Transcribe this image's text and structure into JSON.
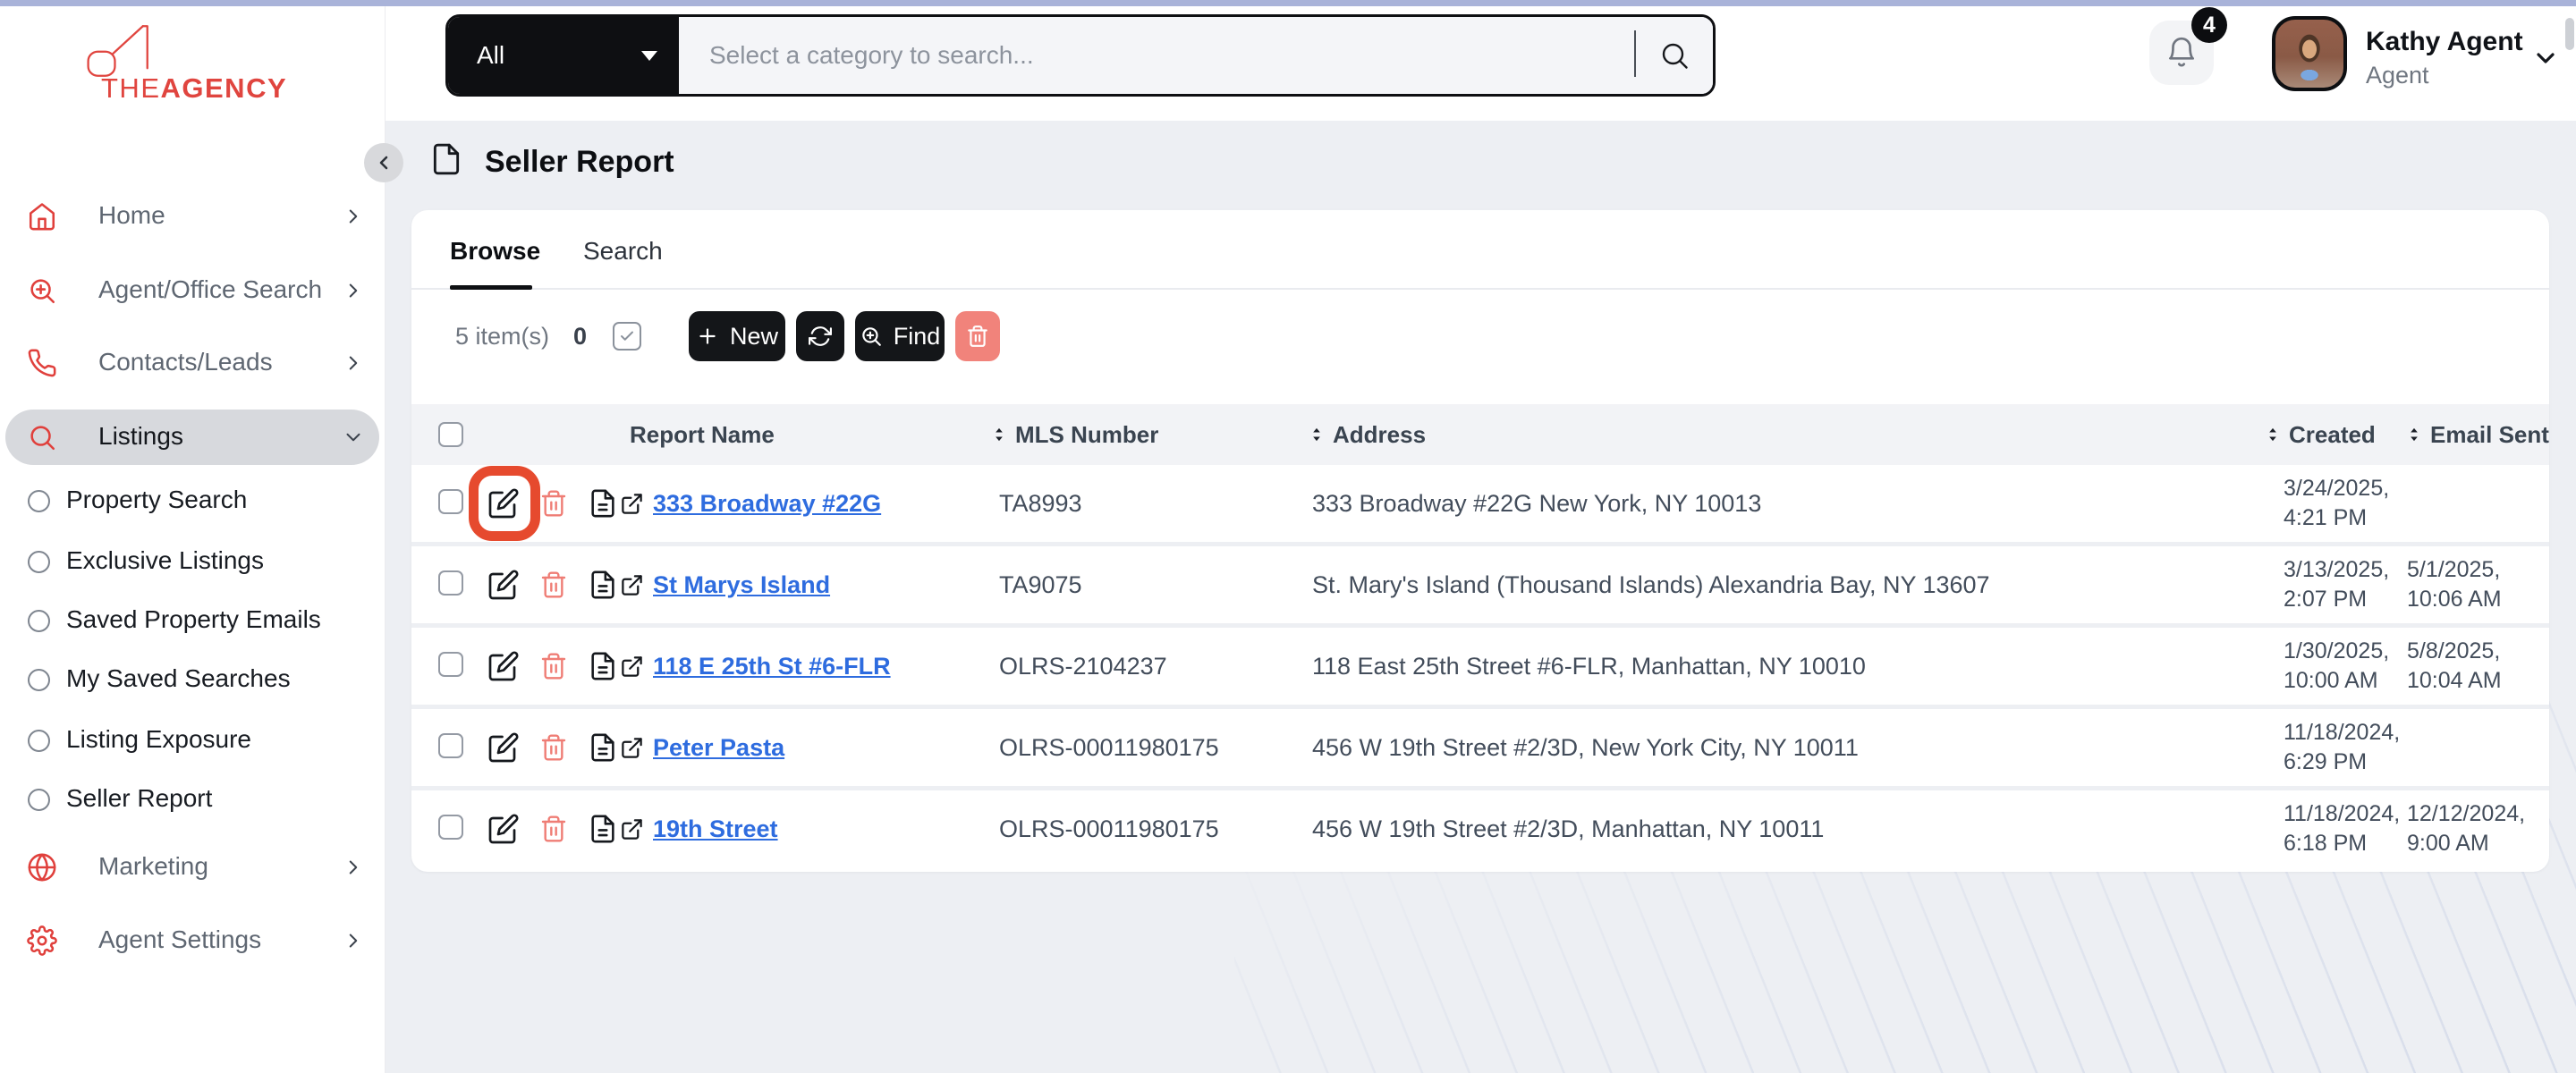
{
  "colors": {
    "brand_red": "#E0453F",
    "link_blue": "#2E6CDF",
    "annotation_red": "#E64A2E",
    "button_black": "#141619",
    "delete_salmon": "#F1837B",
    "top_line": "#A9B3D9",
    "page_background": "#EDEFF3"
  },
  "icons": {
    "logo_mark": "stylized-A",
    "sort": "up-down-triangles",
    "category_caret": "caret-down",
    "bell": "notification-bell",
    "magnifier": "search",
    "edit": "pencil-square",
    "delete": "trash-can",
    "report": "document",
    "open": "external-link",
    "refresh": "circular-arrows",
    "find": "magnifier-plus"
  },
  "brand": {
    "the": "THE",
    "agency": "AGENCY"
  },
  "topbar": {
    "category": "All",
    "search_placeholder": "Select a category to search...",
    "notification_count": "4",
    "user": {
      "name": "Kathy Agent",
      "role": "Agent"
    }
  },
  "sidebar": {
    "items": [
      "Home",
      "Agent/Office Search",
      "Contacts/Leads",
      "Listings",
      "Marketing",
      "Agent Settings"
    ],
    "listings_children": [
      "Property Search",
      "Exclusive Listings",
      "Saved Property Emails",
      "My Saved Searches",
      "Listing Exposure",
      "Seller Report"
    ]
  },
  "page": {
    "title": "Seller Report",
    "tabs": {
      "browse": "Browse",
      "search": "Search"
    }
  },
  "toolbar": {
    "count": "5 item(s)",
    "selected": "0",
    "new_label": "New",
    "find_label": "Find"
  },
  "table": {
    "headers": {
      "report_name": "Report Name",
      "mls": "MLS Number",
      "address": "Address",
      "created": "Created",
      "email_sent": "Email Sent"
    },
    "rows": [
      {
        "name": "333 Broadway #22G",
        "mls": "TA8993",
        "address": "333 Broadway #22G New York, NY 10013",
        "created_d": "3/24/2025,",
        "created_t": "4:21 PM",
        "email_d": "",
        "email_t": ""
      },
      {
        "name": "St Marys Island",
        "mls": "TA9075",
        "address": "St. Mary's Island (Thousand Islands) Alexandria Bay, NY 13607",
        "created_d": "3/13/2025,",
        "created_t": "2:07 PM",
        "email_d": "5/1/2025,",
        "email_t": "10:06 AM"
      },
      {
        "name": "118 E 25th St #6-FLR",
        "mls": "OLRS-2104237",
        "address": "118 East 25th Street #6-FLR, Manhattan, NY 10010",
        "created_d": "1/30/2025,",
        "created_t": "10:00 AM",
        "email_d": "5/8/2025,",
        "email_t": "10:04 AM"
      },
      {
        "name": "Peter Pasta",
        "mls": "OLRS-00011980175",
        "address": "456 W 19th Street #2/3D, New York City, NY 10011",
        "created_d": "11/18/2024,",
        "created_t": "6:29 PM",
        "email_d": "",
        "email_t": ""
      },
      {
        "name": "19th Street",
        "mls": "OLRS-00011980175",
        "address": "456 W 19th Street #2/3D, Manhattan, NY 10011",
        "created_d": "11/18/2024,",
        "created_t": "6:18 PM",
        "email_d": "12/12/2024,",
        "email_t": "9:00 AM"
      }
    ]
  }
}
